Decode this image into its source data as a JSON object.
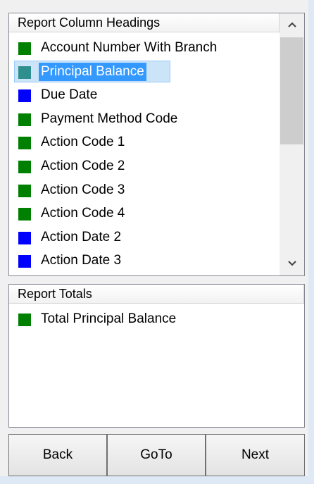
{
  "report_columns": {
    "header": "Report Column Headings",
    "items": [
      {
        "label": "Account Number With Branch",
        "color": "#008000",
        "selected": false
      },
      {
        "label": "Principal Balance",
        "color": "#2f8f8f",
        "selected": true
      },
      {
        "label": "Due Date",
        "color": "#0000ff",
        "selected": false
      },
      {
        "label": "Payment Method Code",
        "color": "#008000",
        "selected": false
      },
      {
        "label": "Action Code 1",
        "color": "#008000",
        "selected": false
      },
      {
        "label": "Action Code 2",
        "color": "#008000",
        "selected": false
      },
      {
        "label": "Action Code 3",
        "color": "#008000",
        "selected": false
      },
      {
        "label": "Action Code 4",
        "color": "#008000",
        "selected": false
      },
      {
        "label": "Action Date 2",
        "color": "#0000ff",
        "selected": false
      },
      {
        "label": "Action Date 3",
        "color": "#0000ff",
        "selected": false
      }
    ],
    "scroll_up_icon": "chevron-up-icon",
    "scroll_down_icon": "chevron-down-icon"
  },
  "report_totals": {
    "header": "Report Totals",
    "items": [
      {
        "label": "Total Principal Balance",
        "color": "#008000"
      }
    ]
  },
  "buttons": {
    "back": "Back",
    "goto": "GoTo",
    "next": "Next"
  }
}
